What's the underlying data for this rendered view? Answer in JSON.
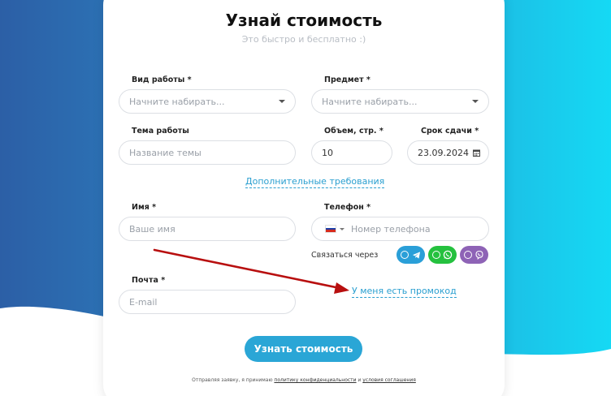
{
  "form": {
    "title": "Узнай стоимость",
    "subtitle": "Это быстро и бесплатно :)",
    "work_type": {
      "label": "Вид работы *",
      "placeholder": "Начните набирать..."
    },
    "subject": {
      "label": "Предмет *",
      "placeholder": "Начните набирать..."
    },
    "topic": {
      "label": "Тема работы",
      "placeholder": "Название темы"
    },
    "volume": {
      "label": "Объем, стр. *",
      "value": "10"
    },
    "deadline": {
      "label": "Срок сдачи *",
      "value": "23.09.2024"
    },
    "extra_link": "Дополнительные требования",
    "name": {
      "label": "Имя *",
      "placeholder": "Ваше имя"
    },
    "phone": {
      "label": "Телефон *",
      "placeholder": "Номер телефона"
    },
    "contact_via": "Связаться через",
    "email": {
      "label": "Почта *",
      "placeholder": "E-mail"
    },
    "promo_link": "У меня есть промокод",
    "submit": "Узнать стоимость",
    "footer": {
      "prefix": "Отправляя заявку, я принимаю ",
      "policy": "политику конфиденциальности",
      "middle": " и ",
      "terms": "условия соглашения"
    }
  },
  "messengers": [
    {
      "icon": "telegram-icon",
      "color": "#2a9fd8"
    },
    {
      "icon": "whatsapp-icon",
      "color": "#25c13f"
    },
    {
      "icon": "viber-icon",
      "color": "#8e63b6"
    }
  ],
  "colors": {
    "accent": "#2aa6d6",
    "annotation_arrow": "#b80f0f",
    "bg_gradient_left": "#2c63a8",
    "bg_gradient_right": "#15d6f2"
  }
}
